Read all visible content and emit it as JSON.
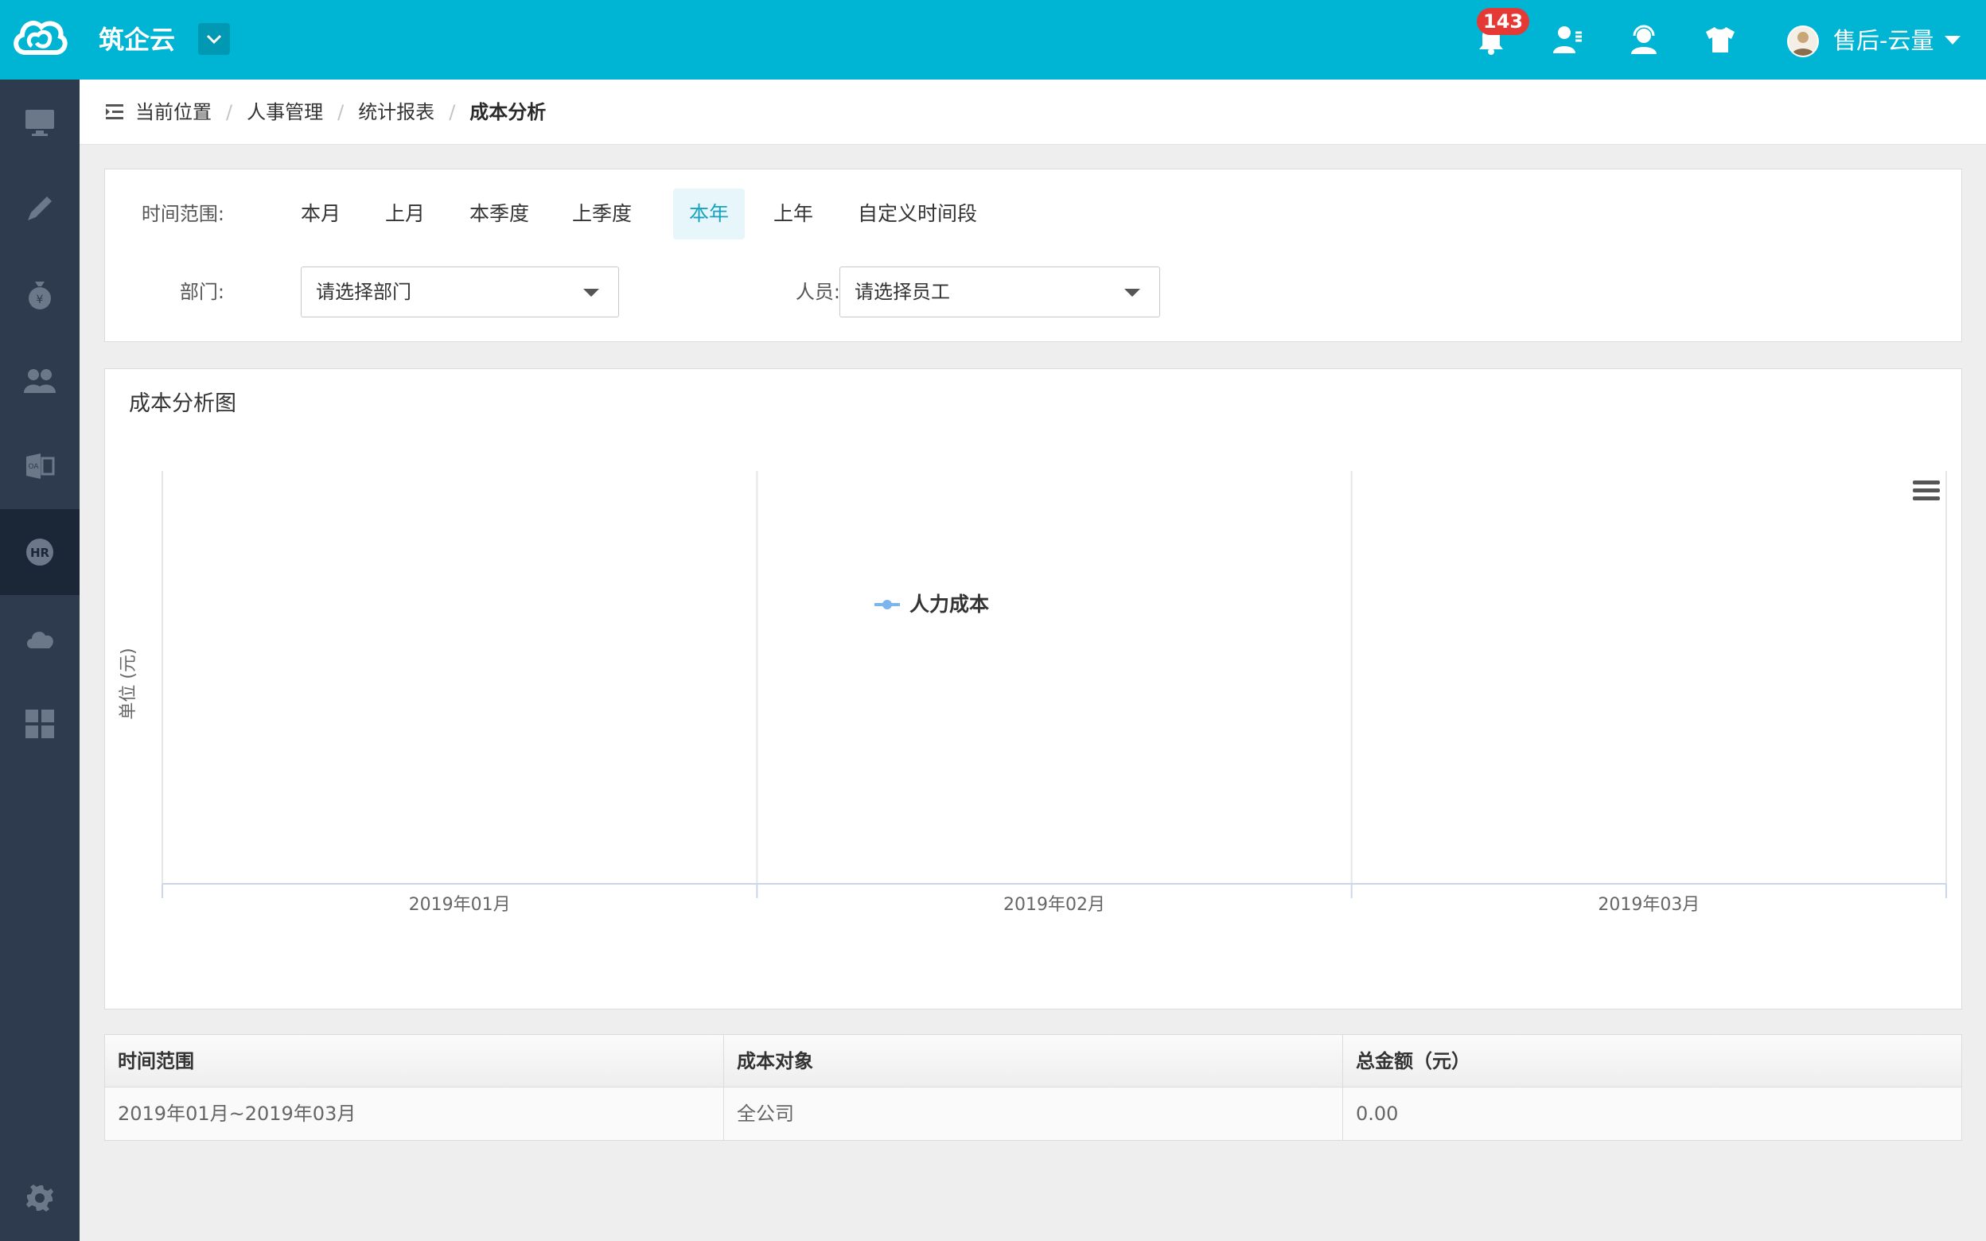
{
  "header": {
    "brand": "筑企云",
    "notification_count": "143",
    "user_name": "售后-云量"
  },
  "breadcrumb": {
    "items": [
      "当前位置",
      "人事管理",
      "统计报表",
      "成本分析"
    ]
  },
  "filters": {
    "time_label": "时间范围:",
    "time_options": [
      "本月",
      "上月",
      "本季度",
      "上季度",
      "本年",
      "上年",
      "自定义时间段"
    ],
    "active_time_option": "本年",
    "department_label": "部门:",
    "department_placeholder": "请选择部门",
    "staff_label": "人员:",
    "staff_placeholder": "请选择员工"
  },
  "chart_card_title": "成本分析图",
  "chart_data": {
    "type": "line",
    "title": "",
    "categories": [
      "2019年01月",
      "2019年02月",
      "2019年03月"
    ],
    "ylabel": "单位 (元)",
    "xlabel": "",
    "series": [
      {
        "name": "人力成本",
        "values": [],
        "color": "#7cb5ec"
      }
    ],
    "grid": true,
    "legend_position": "bottom-center"
  },
  "table": {
    "headers": [
      "时间范围",
      "成本对象",
      "总金额（元）"
    ],
    "rows": [
      [
        "2019年01月~2019年03月",
        "全公司",
        "0.00"
      ]
    ]
  },
  "colors": {
    "topbar": "#00b5d4",
    "sidebar": "#2e3b4e",
    "sidebar_active": "#1b2636",
    "active_option_text": "#17a2c1",
    "badge": "#e53935"
  },
  "icons": {
    "sidebar": [
      "monitor-icon",
      "pencil-icon",
      "money-bag-icon",
      "users-icon",
      "office-icon",
      "hr-icon",
      "cloud-icon",
      "grid-icon",
      "settings-icon"
    ],
    "topbar": [
      "bell-icon",
      "contacts-icon",
      "customer-service-icon",
      "shirt-icon"
    ]
  }
}
